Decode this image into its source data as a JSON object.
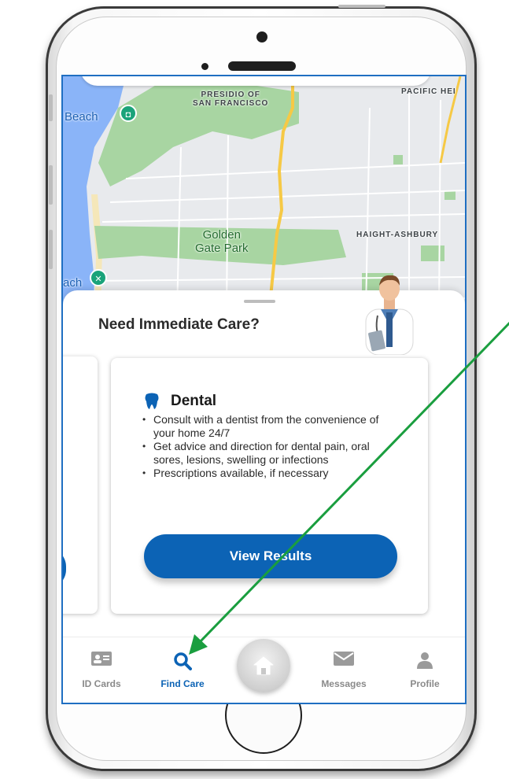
{
  "map": {
    "labels": {
      "presidio": "PRESIDIO OF\nSAN FRANCISCO",
      "pacific": "PACIFIC HEI",
      "beach_top": "Beach",
      "golden_gate": "Golden\nGate Park",
      "haight": "HAIGHT-ASHBURY",
      "beach_bottom": "ach"
    },
    "colors": {
      "water": "#8ab4f8",
      "park": "#a8d5a2",
      "land": "#e8eaed",
      "road": "#ffffff",
      "highway": "#f6c945"
    }
  },
  "sheet": {
    "title": "Need Immediate Care?"
  },
  "card": {
    "title": "Dental",
    "bullets": [
      "Consult with a dentist from the convenience of your home 24/7",
      "Get advice and direction for dental pain, oral sores, lesions, swelling or infections",
      "Prescriptions available, if necessary"
    ],
    "button_label": "View Results"
  },
  "tabs": [
    {
      "label": "ID Cards",
      "icon": "id-card-icon",
      "active": false
    },
    {
      "label": "Find Care",
      "icon": "search-icon",
      "active": true
    },
    {
      "label": "",
      "icon": "home-icon",
      "active": false
    },
    {
      "label": "Messages",
      "icon": "envelope-icon",
      "active": false
    },
    {
      "label": "Profile",
      "icon": "person-icon",
      "active": false
    }
  ],
  "colors": {
    "accent": "#0c63b5",
    "arrow": "#1a9e3f",
    "screen_border": "#1f6fc2"
  }
}
